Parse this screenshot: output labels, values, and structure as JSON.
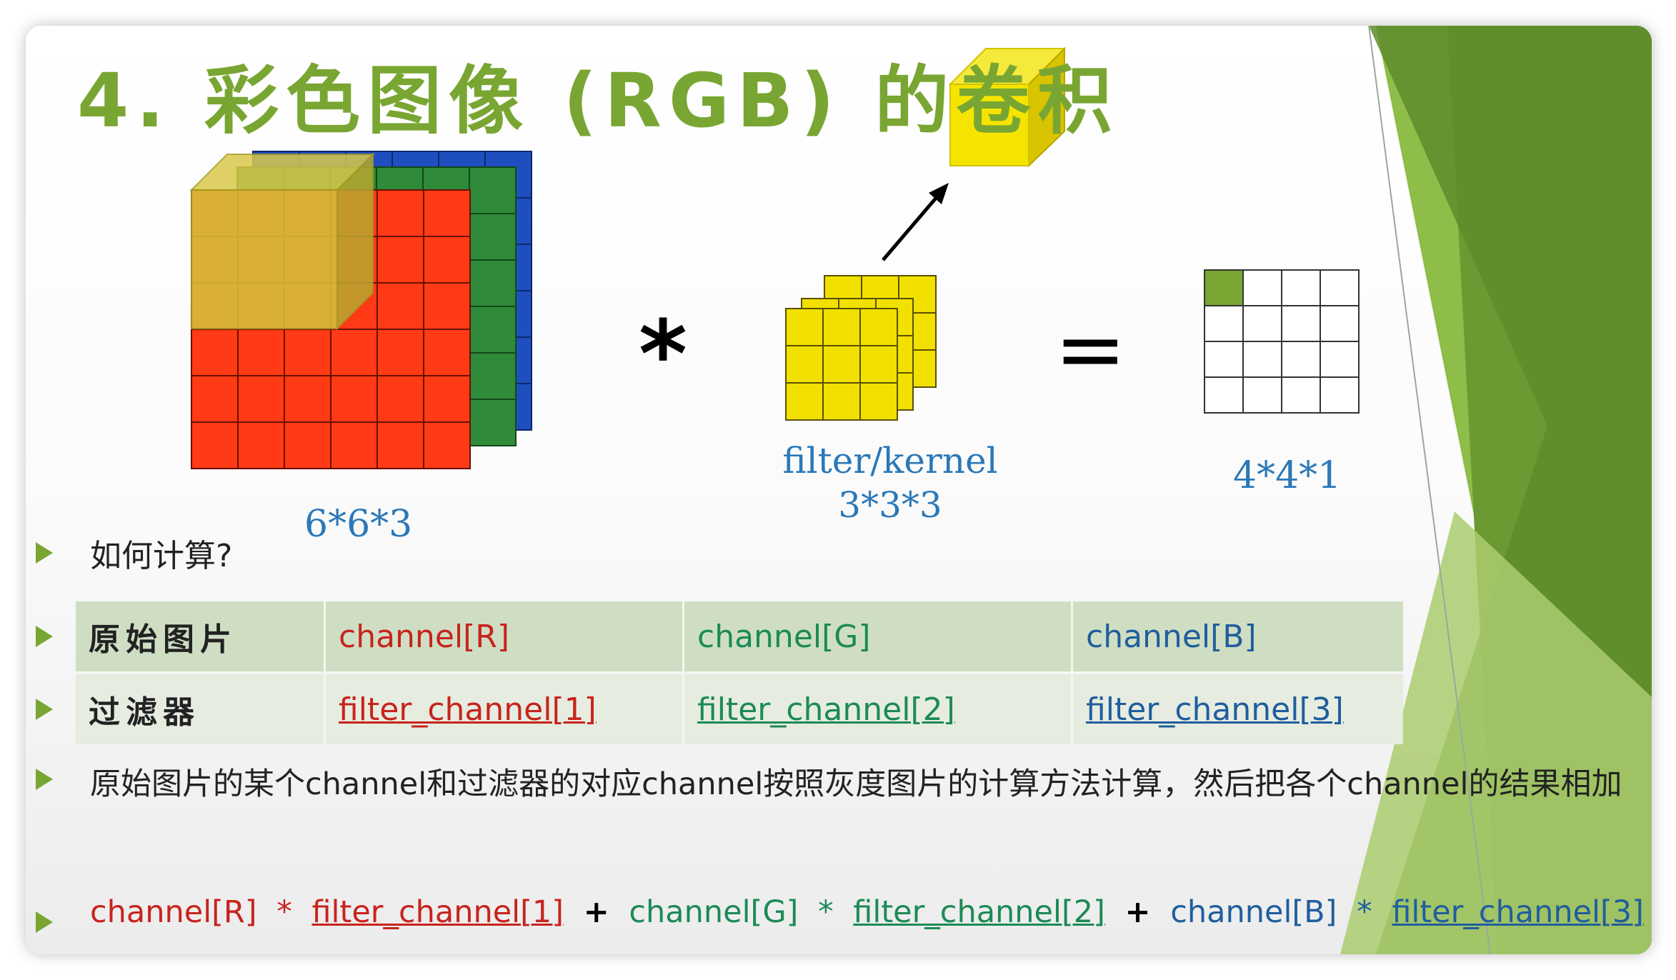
{
  "title": "4. 彩色图像 (RGB) 的卷积",
  "labels": {
    "input_size": "6*6*3",
    "filter_name": "filter/kernel",
    "filter_size": "3*3*3",
    "output_size": "4*4*1"
  },
  "operators": {
    "multiply": "*",
    "equals": "="
  },
  "question": "如何计算?",
  "table": {
    "rows": [
      [
        "原始图片",
        "channel[R]",
        "channel[G]",
        "channel[B]"
      ],
      [
        "过滤器",
        "filter_channel[1]",
        "filter_channel[2]",
        "filter_channel[3]"
      ]
    ]
  },
  "description": "原始图片的某个channel和过滤器的对应channel按照灰度图片的计算方法计算，然后把各个channel的结果相加",
  "formula": {
    "t1": "channel[R]",
    "op1": "*",
    "t2": "filter_channel[1]",
    "plus1": "+",
    "t3": "channel[G]",
    "op2": "*",
    "t4": "filter_channel[2]",
    "plus2": "+",
    "t5": "channel[B]",
    "op3": "*",
    "t6": "filter_channel[3]"
  },
  "colors": {
    "accent_green": "#79a632",
    "red_channel": "#c8231d",
    "green_channel": "#1c8a55",
    "blue_channel": "#1f5e9e",
    "label_blue": "#2b78b8",
    "filter_yellow": "#f2e000"
  }
}
